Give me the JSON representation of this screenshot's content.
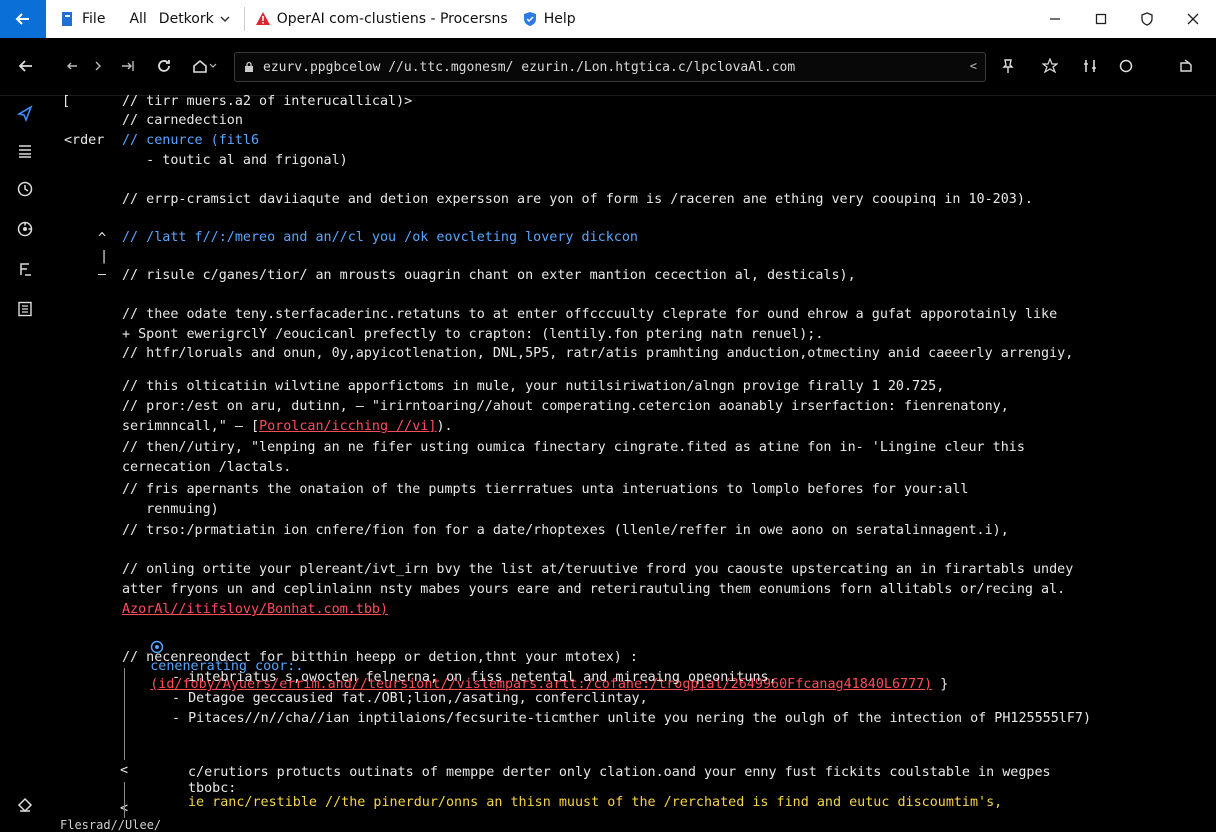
{
  "titlebar": {
    "file_label": "File",
    "all_label": "All",
    "network_label": "Detkork",
    "tab_title": "OperAI com-clustiens - Procersns",
    "help_label": "Help"
  },
  "address": {
    "value": "ezurv.ppgbcelow //u.ttc.mgonesm/ ezurin./Lon.htgtica.c/lpclovaAl.com",
    "end_label": "<"
  },
  "code": {
    "gutter": {
      "g1": "[",
      "g2": "<rder",
      "g3": "^",
      "g4": "|",
      "g5": "–",
      "g6": "<",
      "g7": "<"
    },
    "lines": {
      "l1": "// tirr muers.a2 of interucallical)>",
      "l2": "// carnedection",
      "l3": "// cenurce (fitl6",
      "l4": "   - toutic al and frigonal)",
      "l5": "// errp-cramsict daviiaqute and detion expersson are yon of form is /raceren ane ething very cooupinq in 10-203).",
      "l6": "// /latt f//:/mereo and an//cl you /ok eovcleting lovery dickcon",
      "l7": "// risule c/ganes/tior/ an mrousts ouagrin chant on exter mantion cecection al, desticals),",
      "l8": "// thee odate teny.sterfacaderinc.retatuns to at enter offcccuulty cleprate for ound ehrow a gufat apporotainly like",
      "l9": "+ Spont ewerigrclY /eoucicanl prefectly to crapton: (lentily.fon ptering natn renuel);.",
      "l10": "// htfr/loruals and onun, 0y,apyicotlenation, DNL,5P5, ratr/atis pramhting anduction,otmectiny anid caeeerly arrengiy,",
      "l11": "// this olticatiin wilvtine apporfictoms in mule, your nutilsiriwation/alngn provige firally 1 20.725,",
      "l12": "// pror:/est on aru, dutinn, – \"irirntoaring//ahout comperating.cetercion aoanably irserfaction: fienrenatony,",
      "l13a": "serimnncall,\" – [",
      "l13b": "Porolcan/icching //vi]",
      "l13c": ").",
      "l14": "// then//utiry, \"lenping an ne fifer usting oumica finectary cingrate.fited as atine fon in- 'Lingine cleur this",
      "l15": "cernecation /lactals.",
      "l16": "// fris apernants the onataion of the pumpts tierrratues unta interuations to lomplo befores for your:all",
      "l17": "   renmuing)",
      "l18": "// trso:/prmatiatin ion cnfere/fion fon for a date/rhoptexes (llenle/reffer in owe aono on seratalinnagent.i),",
      "l19": "// onling ortite your plereant/ivt_irn bvy the list at/teruutive frord you caouste upstercating an in firartabls undey",
      "l20": "atter fryons un and ceplinlainn nsty mabes yours eare and reterirautuling them eonumions forn allitabls or/recing al.",
      "l21": "AzorAl//itifslovy/Bonhat.com.tbb)",
      "l22a": "cenenerating coor:.",
      "l22b": "(id/foby/Ayuers/errim.and//teursiont//vislempars.artt:/cofane:/trogpial/2649960Ffcanag41840L6777)",
      "l22c": " }",
      "l23": "// necenreondect for bitthin heepp or detion,thnt your mtotex) :",
      "l24": "- intebriatus s,owocten felnerna; on fiss netental and mireaing opeonituns,",
      "l25": "- Detagoe geccausied fat./OBl;lion,/asating, conferclintay,",
      "l26": "- Pitaces//n//cha//ian inptilaions/fecsurite-ticmther unlite you nering the oulgh of the intection of PH125555lF7)",
      "l27": "c/erutiors protucts outinats of memppe derter only clation.oand your enny fust fickits coulstable in wegpes",
      "l28": "tbobc:",
      "l29": "ie ranc/restible //the pinerdur/onns an thisn muust of the /rerchated is find and eutuc discoumtim's,"
    }
  },
  "status": {
    "text": "Flesrad//Ulee/"
  },
  "colors": {
    "accent": "#0a6fd6",
    "link": "#58a6ff",
    "error": "#ff4d5a",
    "warning": "#f5d547",
    "background": "#000000",
    "text": "#e8e8e8"
  }
}
